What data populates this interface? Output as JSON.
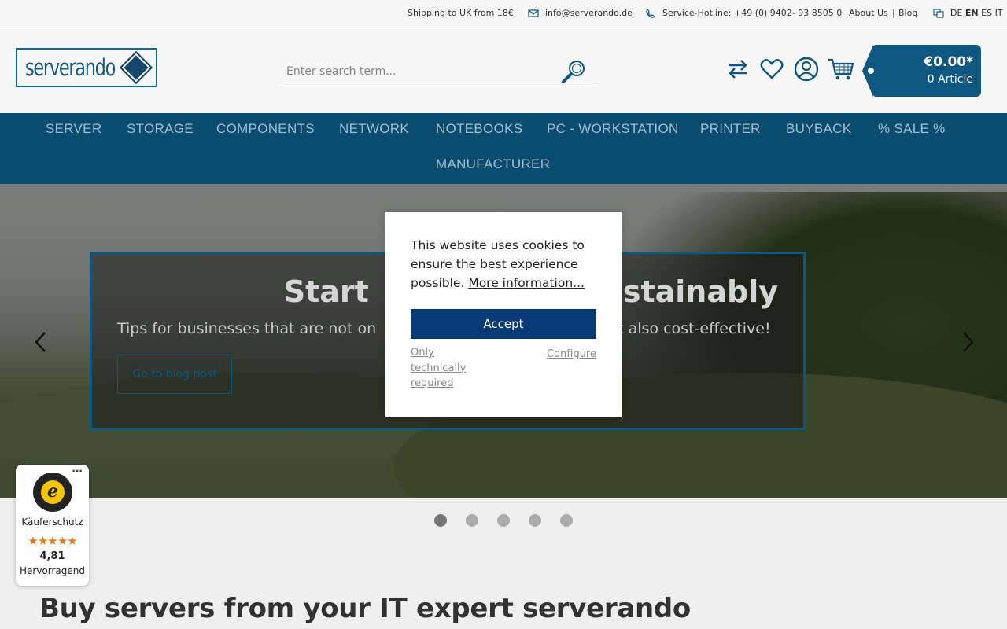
{
  "topbar": {
    "shipping": "Shipping to UK from 18€",
    "email": "info@serverando.de",
    "hotline_label": "Service-Hotline:",
    "hotline_number": "+49 (0) 9402- 93 8505 0",
    "about": "About Us",
    "separator": "|",
    "blog": "Blog",
    "languages": [
      "DE",
      "EN",
      "ES",
      "IT"
    ],
    "active_language": "EN"
  },
  "header": {
    "logo_text": "serverando",
    "search_placeholder": "Enter search term...",
    "cart_price": "€0.00*",
    "cart_count": "0 Article"
  },
  "nav": {
    "items": [
      "SERVER",
      "STORAGE",
      "COMPONENTS",
      "NETWORK",
      "NOTEBOOKS",
      "PC - WORKSTATION",
      "PRINTER",
      "BUYBACK",
      "% SALE %",
      "MANUFACTURER"
    ]
  },
  "hero": {
    "title": "Start ... ustainably",
    "title_left": "Start",
    "title_right": "ustainably",
    "subtitle_left": "Tips for businesses that are not on",
    "subtitle_right": "t also cost-effective!",
    "button": "Go to blog post",
    "slides_total": 5,
    "active_slide": 1
  },
  "main": {
    "heading": "Buy servers from your IT expert serverando"
  },
  "trusted_shops": {
    "more": "···",
    "seal_letter": "e",
    "label": "Käuferschutz",
    "stars": "★★★★★",
    "score": "4,81",
    "grade": "Hervorragend"
  },
  "cookie": {
    "message": "This website uses cookies to ensure the best experience possible.",
    "more_info": "More information...",
    "accept": "Accept",
    "only_required": "Only technically required",
    "configure": "Configure"
  },
  "colors": {
    "brand_blue": "#0f5a86",
    "nav_bg": "#0a4f74",
    "accept_bg": "#0a3a75",
    "star_orange": "#e47a1c"
  }
}
